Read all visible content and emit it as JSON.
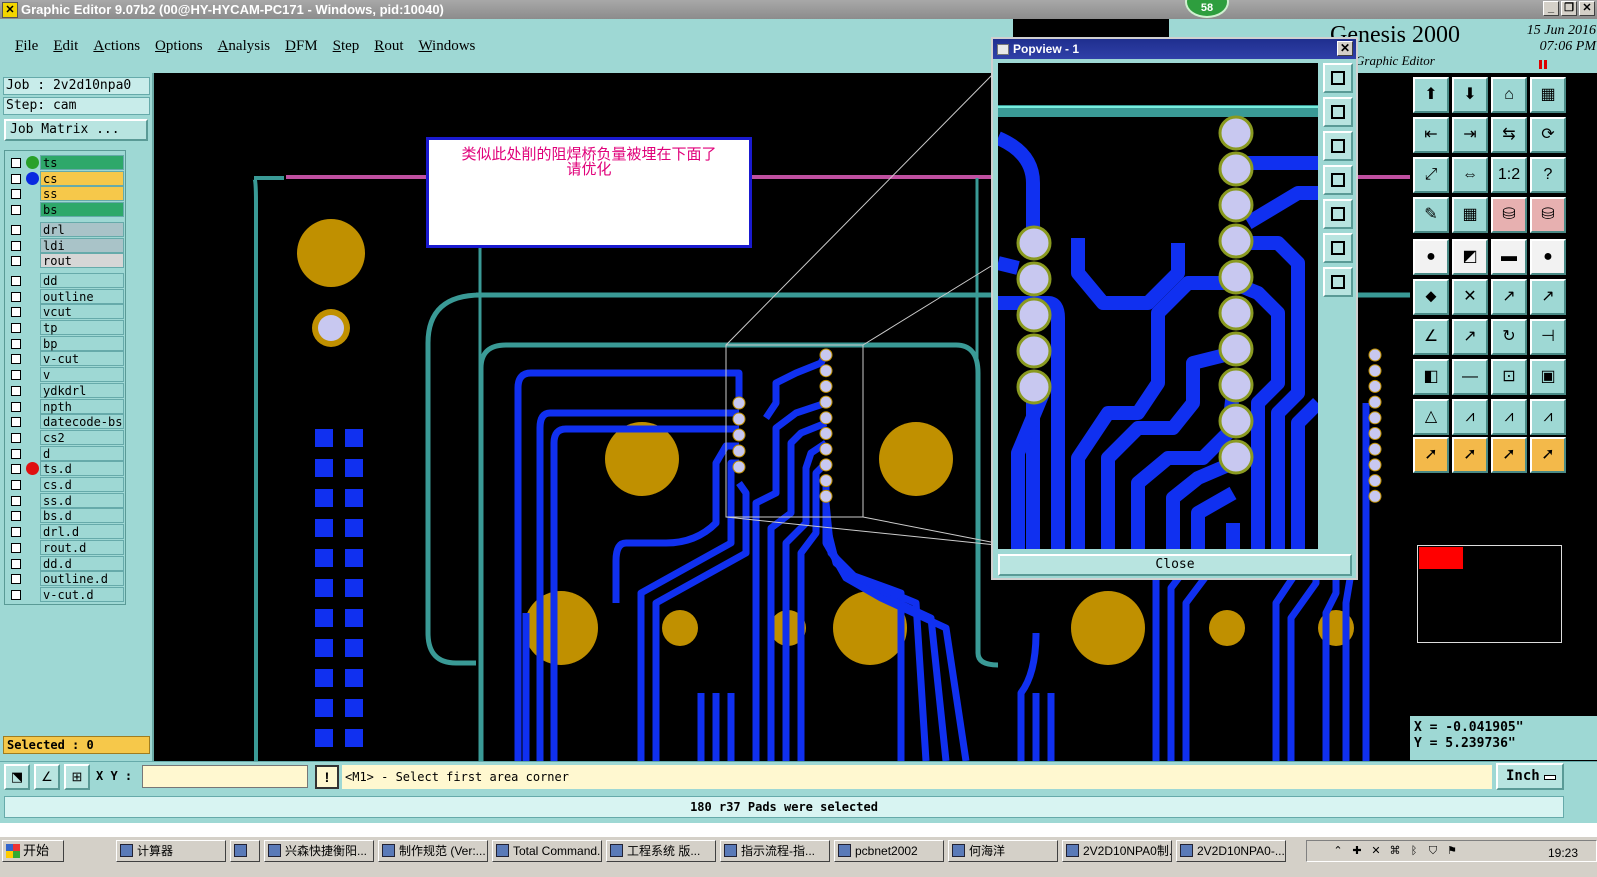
{
  "titlebar": {
    "title": "Graphic Editor 9.07b2 (00@HY-HYCAM-PC171 - Windows, pid:10040)",
    "notification_count": "58"
  },
  "menu": [
    "File",
    "Edit",
    "Actions",
    "Options",
    "Analysis",
    "DFM",
    "Step",
    "Rout",
    "Windows"
  ],
  "brand": {
    "name": "Genesis 2000",
    "date": "15 Jun 2016",
    "time": "07:06 PM",
    "subtitle": "Graphic Editor"
  },
  "job": {
    "job_line": "Job : 2v2d10npa0",
    "step_line": "Step: cam",
    "matrix_button": "Job Matrix ..."
  },
  "layers": [
    {
      "name": "ts",
      "color": "#2ea86a",
      "dot": "#2aa02a"
    },
    {
      "name": "cs",
      "color": "#f6c84a",
      "dot": "#0a2ae0"
    },
    {
      "name": "ss",
      "color": "#f6c84a",
      "dot": ""
    },
    {
      "name": "bs",
      "color": "#2ea86a",
      "dot": ""
    },
    {
      "name": "drl",
      "color": "#a9c3c8",
      "dot": ""
    },
    {
      "name": "ldi",
      "color": "#a9c3c8",
      "dot": ""
    },
    {
      "name": "rout",
      "color": "#d6d6d6",
      "dot": ""
    },
    {
      "name": "dd",
      "color": "#9ed8d4",
      "dot": ""
    },
    {
      "name": "outline",
      "color": "#9ed8d4",
      "dot": ""
    },
    {
      "name": "vcut",
      "color": "#9ed8d4",
      "dot": ""
    },
    {
      "name": "tp",
      "color": "#9ed8d4",
      "dot": ""
    },
    {
      "name": "bp",
      "color": "#9ed8d4",
      "dot": ""
    },
    {
      "name": "v-cut",
      "color": "#9ed8d4",
      "dot": ""
    },
    {
      "name": "v",
      "color": "#9ed8d4",
      "dot": ""
    },
    {
      "name": "ydkdrl",
      "color": "#9ed8d4",
      "dot": ""
    },
    {
      "name": "npth",
      "color": "#9ed8d4",
      "dot": ""
    },
    {
      "name": "datecode-bs",
      "color": "#9ed8d4",
      "dot": ""
    },
    {
      "name": "cs2",
      "color": "#9ed8d4",
      "dot": ""
    },
    {
      "name": "d",
      "color": "#9ed8d4",
      "dot": ""
    },
    {
      "name": "ts.d",
      "color": "#9ed8d4",
      "dot": "#e01010"
    },
    {
      "name": "cs.d",
      "color": "#9ed8d4",
      "dot": ""
    },
    {
      "name": "ss.d",
      "color": "#9ed8d4",
      "dot": ""
    },
    {
      "name": "bs.d",
      "color": "#9ed8d4",
      "dot": ""
    },
    {
      "name": "drl.d",
      "color": "#9ed8d4",
      "dot": ""
    },
    {
      "name": "rout.d",
      "color": "#9ed8d4",
      "dot": ""
    },
    {
      "name": "dd.d",
      "color": "#9ed8d4",
      "dot": ""
    },
    {
      "name": "outline.d",
      "color": "#9ed8d4",
      "dot": ""
    },
    {
      "name": "v-cut.d",
      "color": "#9ed8d4",
      "dot": ""
    }
  ],
  "selected_text": "Selected : 0",
  "annotation": {
    "line1": "类似此处削的阻焊桥负量被埋在下面了",
    "line2": "请优化"
  },
  "popview": {
    "title": "Popview - 1",
    "close_label": "Close"
  },
  "coords": {
    "x": "X = -0.041905\"",
    "y": "Y = 5.239736\""
  },
  "xy": {
    "label": "X Y :",
    "value": "",
    "prompt": "<M1> - Select first area corner",
    "units": "Inch"
  },
  "status": "180 r37 Pads were selected",
  "taskbar": {
    "start": "开始",
    "tasks": [
      "计算器",
      "",
      "兴森快捷衡阳...",
      "制作规范 (Ver:...",
      "Total Command...",
      "工程系统  版...",
      "指示流程-指...",
      "pcbnet2002",
      "何海洋",
      "2V2D10NPA0制...",
      "2V2D10NPA0-..."
    ],
    "clock": "19:23"
  },
  "colors": {
    "panel": "#9ed8d4",
    "trace": "#1030f0",
    "pad": "#c09000",
    "outline": "#3a9a96",
    "annotation_text": "#e0007a"
  }
}
